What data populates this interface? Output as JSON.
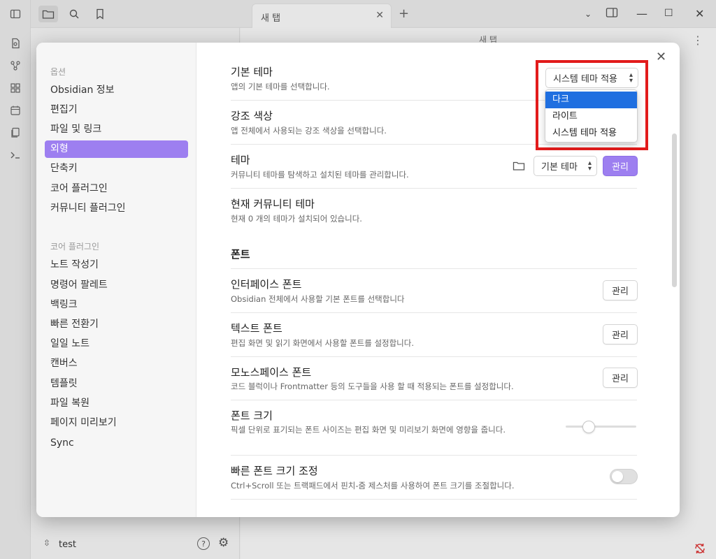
{
  "tab": {
    "title": "새 탭"
  },
  "editor": {
    "title": "새 탭"
  },
  "vault": {
    "name": "test"
  },
  "nav": {
    "options_header": "옵션",
    "options": [
      "Obsidian 정보",
      "편집기",
      "파일 및 링크",
      "외형",
      "단축키",
      "코어 플러그인",
      "커뮤니티 플러그인"
    ],
    "active": "외형",
    "core_header": "코어 플러그인",
    "core": [
      "노트 작성기",
      "명령어 팔레트",
      "백링크",
      "빠른 전환기",
      "일일 노트",
      "캔버스",
      "템플릿",
      "파일 복원",
      "페이지 미리보기",
      "Sync"
    ]
  },
  "settings": {
    "base_theme": {
      "title": "기본 테마",
      "desc": "앱의 기본 테마를 선택합니다.",
      "value": "시스템 테마 적용"
    },
    "accent_color": {
      "title": "강조 색상",
      "desc": "앱 전체에서 사용되는 강조 색상을 선택합니다."
    },
    "theme": {
      "title": "테마",
      "desc": "커뮤니티 테마를 탐색하고 설치된 테마를 관리합니다.",
      "value": "기본 테마",
      "manage": "관리"
    },
    "current_theme": {
      "title": "현재 커뮤니티 테마",
      "desc": "현재 0 개의 테마가 설치되어 있습니다."
    },
    "font_section": "폰트",
    "interface_font": {
      "title": "인터페이스 폰트",
      "desc": "Obsidian 전체에서 사용할 기본 폰트를 선택합니다",
      "button": "관리"
    },
    "text_font": {
      "title": "텍스트 폰트",
      "desc": "편집 화면 및 읽기 화면에서 사용할 폰트를 설정합니다.",
      "button": "관리"
    },
    "mono_font": {
      "title": "모노스페이스 폰트",
      "desc": "코드 블럭이나 Frontmatter 등의 도구들을 사용 할 때 적용되는 폰트를 설정합니다.",
      "button": "관리"
    },
    "font_size": {
      "title": "폰트 크기",
      "desc": "픽셀 단위로 표기되는 폰트 사이즈는 편집 화면 및 미리보기 화면에 영향을 줍니다.",
      "slider_fraction": 0.33
    },
    "quick_font": {
      "title": "빠른 폰트 크기 조정",
      "desc": "Ctrl+Scroll 또는 트랙패드에서 핀치-줌 제스처를 사용하여 폰트 크기를 조절합니다.",
      "enabled": false
    }
  },
  "dropdown": {
    "options": [
      "다크",
      "라이트",
      "시스템 테마 적용"
    ],
    "selected": "다크"
  },
  "colors": {
    "accent": "#9d7ff0",
    "highlight": "#e21b1b",
    "selection": "#1f6fe0"
  }
}
